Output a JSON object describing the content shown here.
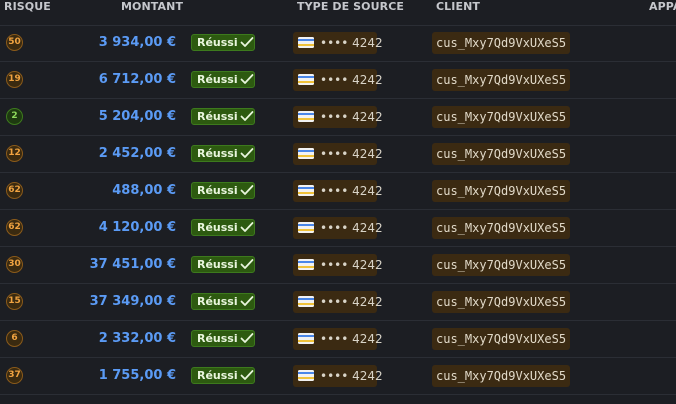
{
  "header": {
    "risk": "RISQUE",
    "amount": "MONTANT",
    "source_type": "TYPE DE SOURCE",
    "client": "CLIENT",
    "app": "APPA"
  },
  "colors": {
    "amount": "#5b9bf5",
    "status_bg": "#2d5a10",
    "risk_warning": "#f0a341",
    "risk_ok": "#8fdc5c",
    "chip_bg": "#3b2a12"
  },
  "status_icon": "check-icon",
  "source_icon": "credit-card-icon",
  "rows": [
    {
      "risk": "50",
      "risk_level": "warning",
      "amount": "3 934,00 €",
      "status": "Réussi",
      "source": "•••• 4242",
      "client": "cus_Mxy7Qd9VxUXeS5"
    },
    {
      "risk": "19",
      "risk_level": "warning",
      "amount": "6 712,00 €",
      "status": "Réussi",
      "source": "•••• 4242",
      "client": "cus_Mxy7Qd9VxUXeS5"
    },
    {
      "risk": "2",
      "risk_level": "low",
      "amount": "5 204,00 €",
      "status": "Réussi",
      "source": "•••• 4242",
      "client": "cus_Mxy7Qd9VxUXeS5"
    },
    {
      "risk": "12",
      "risk_level": "warning",
      "amount": "2 452,00 €",
      "status": "Réussi",
      "source": "•••• 4242",
      "client": "cus_Mxy7Qd9VxUXeS5"
    },
    {
      "risk": "62",
      "risk_level": "warning",
      "amount": "488,00 €",
      "status": "Réussi",
      "source": "•••• 4242",
      "client": "cus_Mxy7Qd9VxUXeS5"
    },
    {
      "risk": "62",
      "risk_level": "warning",
      "amount": "4 120,00 €",
      "status": "Réussi",
      "source": "•••• 4242",
      "client": "cus_Mxy7Qd9VxUXeS5"
    },
    {
      "risk": "30",
      "risk_level": "warning",
      "amount": "37 451,00 €",
      "status": "Réussi",
      "source": "•••• 4242",
      "client": "cus_Mxy7Qd9VxUXeS5"
    },
    {
      "risk": "15",
      "risk_level": "warning",
      "amount": "37 349,00 €",
      "status": "Réussi",
      "source": "•••• 4242",
      "client": "cus_Mxy7Qd9VxUXeS5"
    },
    {
      "risk": "6",
      "risk_level": "warning",
      "amount": "2 332,00 €",
      "status": "Réussi",
      "source": "•••• 4242",
      "client": "cus_Mxy7Qd9VxUXeS5"
    },
    {
      "risk": "37",
      "risk_level": "warning",
      "amount": "1 755,00 €",
      "status": "Réussi",
      "source": "•••• 4242",
      "client": "cus_Mxy7Qd9VxUXeS5"
    }
  ]
}
